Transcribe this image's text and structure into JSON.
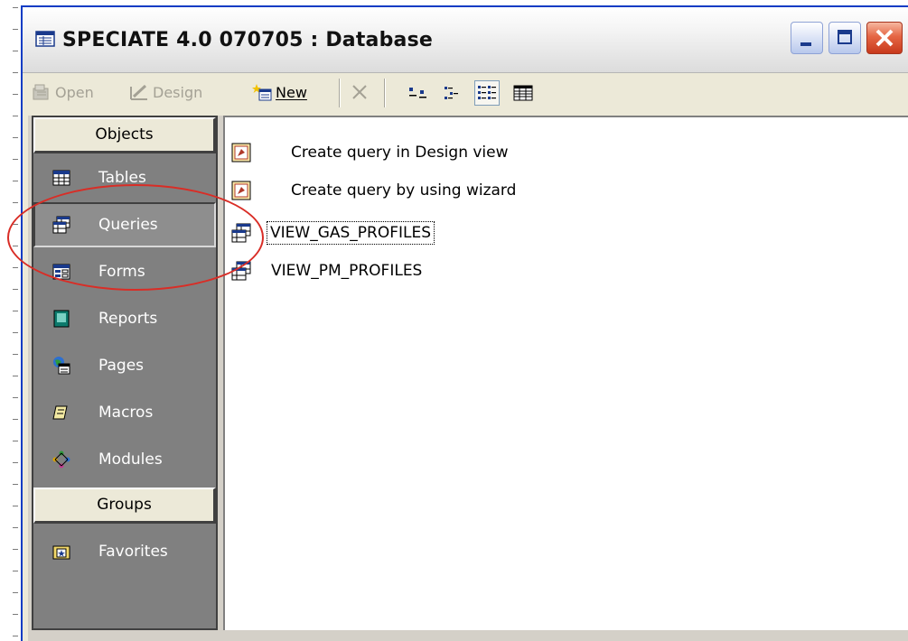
{
  "window": {
    "title": "SPECIATE 4.0 070705 : Database",
    "title_icon": "database-window-icon",
    "controls": [
      "minimize",
      "maximize",
      "close"
    ]
  },
  "toolbar": {
    "open_label": "Open",
    "design_label": "Design",
    "new_label": "New",
    "delete_icon": "delete-x-icon",
    "view_buttons": [
      "large-icons-view",
      "small-icons-view",
      "list-view",
      "details-view"
    ],
    "active_view": "list-view"
  },
  "sidebar": {
    "objects_header": "Objects",
    "items": [
      {
        "label": "Tables",
        "icon": "table-icon"
      },
      {
        "label": "Queries",
        "icon": "query-icon",
        "selected": true
      },
      {
        "label": "Forms",
        "icon": "form-icon"
      },
      {
        "label": "Reports",
        "icon": "report-icon"
      },
      {
        "label": "Pages",
        "icon": "page-icon"
      },
      {
        "label": "Macros",
        "icon": "macro-icon"
      },
      {
        "label": "Modules",
        "icon": "module-icon"
      }
    ],
    "groups_header": "Groups",
    "groups": [
      {
        "label": "Favorites",
        "icon": "favorites-folder-icon"
      }
    ]
  },
  "main": {
    "items": [
      {
        "label": "Create query in Design view",
        "icon": "design-shortcut-icon"
      },
      {
        "label": "Create query by using wizard",
        "icon": "wizard-shortcut-icon"
      },
      {
        "label": "VIEW_GAS_PROFILES",
        "icon": "query-icon",
        "focused": true
      },
      {
        "label": "VIEW_PM_PROFILES",
        "icon": "query-icon"
      }
    ]
  },
  "colors": {
    "sidebar_bg": "#808080",
    "highlight_ellipse": "#d92d26",
    "window_face": "#ece9d8"
  }
}
